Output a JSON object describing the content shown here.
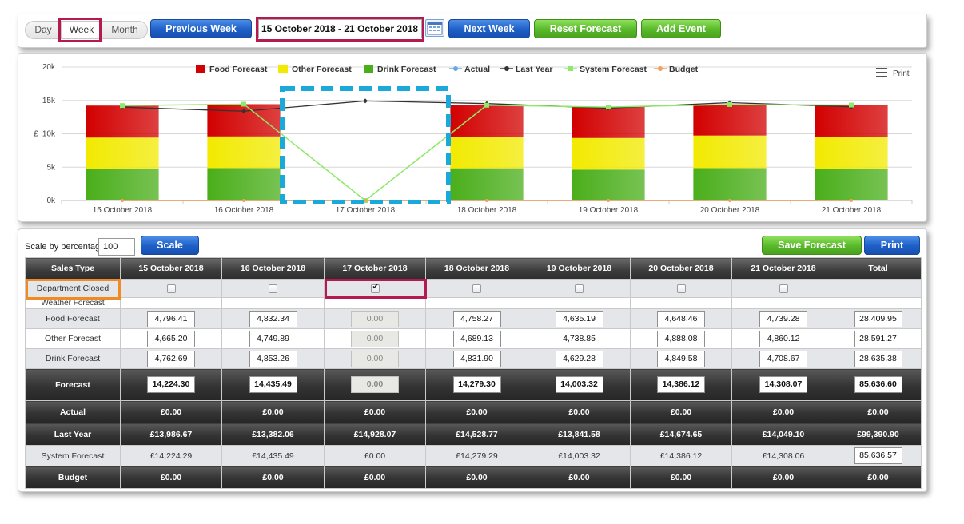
{
  "toolbar": {
    "views": [
      "Day",
      "Week",
      "Month"
    ],
    "active_view": "Week",
    "previous_label": "Previous Week",
    "date_range": "15 October 2018 - 21 October 2018",
    "next_label": "Next Week",
    "reset_label": "Reset Forecast",
    "add_event_label": "Add Event",
    "calendar_icon": "calendar-icon"
  },
  "chart_data": {
    "type": "bar",
    "stacked": true,
    "categories": [
      "15 October 2018",
      "16 October 2018",
      "17 October 2018",
      "18 October 2018",
      "19 October 2018",
      "20 October 2018",
      "21 October 2018"
    ],
    "ylabel": "£",
    "ylim": [
      0,
      20000
    ],
    "yticks": [
      "0k",
      "5k",
      "10k",
      "15k",
      "20k"
    ],
    "legend": [
      "Food Forecast",
      "Other Forecast",
      "Drink Forecast",
      "Actual",
      "Last Year",
      "System Forecast",
      "Budget"
    ],
    "legend_placement": "top",
    "print_label": "Print",
    "series": [
      {
        "name": "Drink Forecast",
        "kind": "bar",
        "color": "#4aae1a",
        "values": [
          4762.69,
          4853.26,
          0,
          4831.9,
          4629.28,
          4849.58,
          4708.67
        ]
      },
      {
        "name": "Other Forecast",
        "kind": "bar",
        "color": "#f2ea00",
        "values": [
          4665.2,
          4749.89,
          0,
          4689.13,
          4738.85,
          4888.08,
          4860.12
        ]
      },
      {
        "name": "Food Forecast",
        "kind": "bar",
        "color": "#d20000",
        "values": [
          4796.41,
          4832.34,
          0,
          4758.27,
          4635.19,
          4648.46,
          4739.28
        ]
      },
      {
        "name": "Actual",
        "kind": "line",
        "color": "#6aa6e0",
        "values": [
          0,
          0,
          0,
          0,
          0,
          0,
          0
        ]
      },
      {
        "name": "Last Year",
        "kind": "line",
        "color": "#333333",
        "values": [
          13986.67,
          13382.06,
          14928.07,
          14528.77,
          13841.58,
          14674.65,
          14049.1
        ]
      },
      {
        "name": "System Forecast",
        "kind": "line",
        "color": "#8ee86a",
        "values": [
          14224.29,
          14435.49,
          0,
          14279.29,
          14003.32,
          14386.12,
          14308.06
        ]
      },
      {
        "name": "Budget",
        "kind": "line",
        "color": "#f5a05a",
        "values": [
          0,
          0,
          0,
          0,
          0,
          0,
          0
        ]
      }
    ]
  },
  "colors": {
    "highlight_red": "#b5194f",
    "highlight_orange": "#f08a24",
    "highlight_dash": "#1aa9d8"
  },
  "table": {
    "scale_label": "Scale by percentage",
    "scale_value": "100",
    "scale_button": "Scale",
    "save_button": "Save Forecast",
    "print_button": "Print",
    "headers": [
      "Sales Type",
      "15 October 2018",
      "16 October 2018",
      "17 October 2018",
      "18 October 2018",
      "19 October 2018",
      "20 October 2018",
      "21 October 2018",
      "Total"
    ],
    "dept_closed_label": "Department Closed",
    "dept_closed": [
      false,
      false,
      true,
      false,
      false,
      false,
      false
    ],
    "weather_label": "Weather Forecast",
    "rows": {
      "food": {
        "label": "Food Forecast",
        "values": [
          "4,796.41",
          "4,832.34",
          "0.00",
          "4,758.27",
          "4,635.19",
          "4,648.46",
          "4,739.28"
        ],
        "total": "28,409.95"
      },
      "other": {
        "label": "Other Forecast",
        "values": [
          "4,665.20",
          "4,749.89",
          "0.00",
          "4,689.13",
          "4,738.85",
          "4,888.08",
          "4,860.12"
        ],
        "total": "28,591.27"
      },
      "drink": {
        "label": "Drink Forecast",
        "values": [
          "4,762.69",
          "4,853.26",
          "0.00",
          "4,831.90",
          "4,629.28",
          "4,849.58",
          "4,708.67"
        ],
        "total": "28,635.38"
      },
      "forecast": {
        "label": "Forecast",
        "values": [
          "14,224.30",
          "14,435.49",
          "0.00",
          "14,279.30",
          "14,003.32",
          "14,386.12",
          "14,308.07"
        ],
        "total": "85,636.60"
      },
      "actual": {
        "label": "Actual",
        "values": [
          "£0.00",
          "£0.00",
          "£0.00",
          "£0.00",
          "£0.00",
          "£0.00",
          "£0.00"
        ],
        "total": "£0.00"
      },
      "last_year": {
        "label": "Last Year",
        "values": [
          "£13,986.67",
          "£13,382.06",
          "£14,928.07",
          "£14,528.77",
          "£13,841.58",
          "£14,674.65",
          "£14,049.10"
        ],
        "total": "£99,390.90"
      },
      "system": {
        "label": "System Forecast",
        "values": [
          "£14,224.29",
          "£14,435.49",
          "£0.00",
          "£14,279.29",
          "£14,003.32",
          "£14,386.12",
          "£14,308.06"
        ],
        "total": "85,636.57"
      },
      "budget": {
        "label": "Budget",
        "values": [
          "£0.00",
          "£0.00",
          "£0.00",
          "£0.00",
          "£0.00",
          "£0.00",
          "£0.00"
        ],
        "total": "£0.00"
      }
    },
    "disabled_column": 2
  }
}
